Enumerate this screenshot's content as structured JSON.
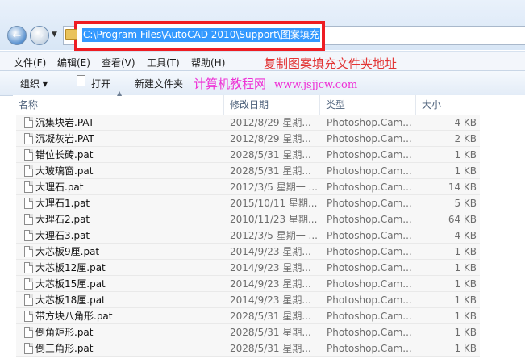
{
  "address": {
    "path": "C:\\Program Files\\AutoCAD 2010\\Support\\图案填充"
  },
  "menu": [
    "文件(F)",
    "编辑(E)",
    "查看(V)",
    "工具(T)",
    "帮助(H)"
  ],
  "annotations": {
    "copy_hint": "复制图案填充文件夹地址",
    "site_name": "计算机教程网",
    "site_url": "www.jsjjcw.com",
    "copy_color": "#e23434",
    "site_color": "#ee2fd5"
  },
  "toolbar": {
    "organize": "组织 ▾",
    "open": "打开",
    "new_folder": "新建文件夹"
  },
  "columns": {
    "name": "名称",
    "date": "修改日期",
    "type": "类型",
    "size": "大小"
  },
  "files": [
    {
      "name": "沉集块岩.PAT",
      "date": "2012/8/29 星期...",
      "type": "Photoshop.Cam...",
      "size": "4 KB"
    },
    {
      "name": "沉凝灰岩.PAT",
      "date": "2012/8/29 星期...",
      "type": "Photoshop.Cam...",
      "size": "2 KB"
    },
    {
      "name": "错位长砖.pat",
      "date": "2028/5/31 星期...",
      "type": "Photoshop.Cam...",
      "size": "1 KB"
    },
    {
      "name": "大玻璃窗.pat",
      "date": "2028/5/31 星期...",
      "type": "Photoshop.Cam...",
      "size": "1 KB"
    },
    {
      "name": "大理石.pat",
      "date": "2012/3/5 星期一 ...",
      "type": "Photoshop.Cam...",
      "size": "14 KB"
    },
    {
      "name": "大理石1.pat",
      "date": "2015/10/11 星期...",
      "type": "Photoshop.Cam...",
      "size": "5 KB"
    },
    {
      "name": "大理石2.pat",
      "date": "2010/11/23 星期...",
      "type": "Photoshop.Cam...",
      "size": "64 KB"
    },
    {
      "name": "大理石3.pat",
      "date": "2012/3/5 星期一 ...",
      "type": "Photoshop.Cam...",
      "size": "4 KB"
    },
    {
      "name": "大芯板9厘.pat",
      "date": "2014/9/23 星期...",
      "type": "Photoshop.Cam...",
      "size": "1 KB"
    },
    {
      "name": "大芯板12厘.pat",
      "date": "2014/9/23 星期...",
      "type": "Photoshop.Cam...",
      "size": "1 KB"
    },
    {
      "name": "大芯板15厘.pat",
      "date": "2014/9/23 星期...",
      "type": "Photoshop.Cam...",
      "size": "1 KB"
    },
    {
      "name": "大芯板18厘.pat",
      "date": "2014/9/23 星期...",
      "type": "Photoshop.Cam...",
      "size": "1 KB"
    },
    {
      "name": "带方块八角形.pat",
      "date": "2028/5/31 星期...",
      "type": "Photoshop.Cam...",
      "size": "1 KB"
    },
    {
      "name": "倒角矩形.pat",
      "date": "2028/5/31 星期...",
      "type": "Photoshop.Cam...",
      "size": "1 KB"
    },
    {
      "name": "倒三角形.pat",
      "date": "2028/5/31 星期...",
      "type": "Photoshop.Cam...",
      "size": "1 KB"
    }
  ]
}
